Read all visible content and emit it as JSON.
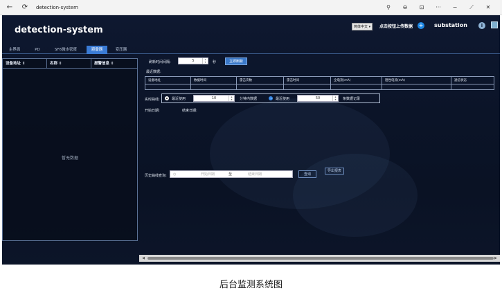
{
  "browser": {
    "tab_title": "detection-system",
    "back_glyph": "←",
    "refresh_glyph": "⟳",
    "controls": [
      "⚲",
      "⊖",
      "⊡",
      "···",
      "−",
      "⟋",
      "✕"
    ]
  },
  "header": {
    "app_title": "detection-system",
    "language": "简体中文",
    "upload_text": "点击按钮上传数据",
    "station": "substation",
    "upload_glyph": "+",
    "info_glyph": "i"
  },
  "tabs": [
    "主界面",
    "PD",
    "SF6微水密度",
    "避雷器",
    "变压器"
  ],
  "active_tab": 3,
  "left_table": {
    "columns": [
      "设备地址 ⇕",
      "名称 ⇕",
      "报警信息 ⇕"
    ],
    "empty_text": "暂无数据"
  },
  "controls": {
    "refresh_label": "刷新时间间隔:",
    "refresh_value": "5",
    "refresh_unit": "秒",
    "refresh_button": "立即刷新",
    "latest_label": "最近数据:",
    "realtime_label": "实时曲线:",
    "recent_use_1": "最近使用",
    "recent_value_1": "10",
    "unit_minutes": "分钟内数据",
    "recent_use_2": "最近使用",
    "recent_value_2": "50",
    "unit_records": "条数据记录",
    "start_date_label": "开始日期:",
    "end_date_label": "结束日期:",
    "history_label": "历史曲线查询:",
    "start_placeholder": "开始日期",
    "date_separator": "至",
    "end_placeholder": "结束日期",
    "query_button": "查询",
    "export_button": "导出报表"
  },
  "data_table": {
    "columns": [
      "设备地址",
      "数据时间",
      "雷击次数",
      "雷击时间",
      "全电流(mA)",
      "阻性电流(mA)",
      "通信状态"
    ]
  },
  "caption": "后台监测系统图"
}
